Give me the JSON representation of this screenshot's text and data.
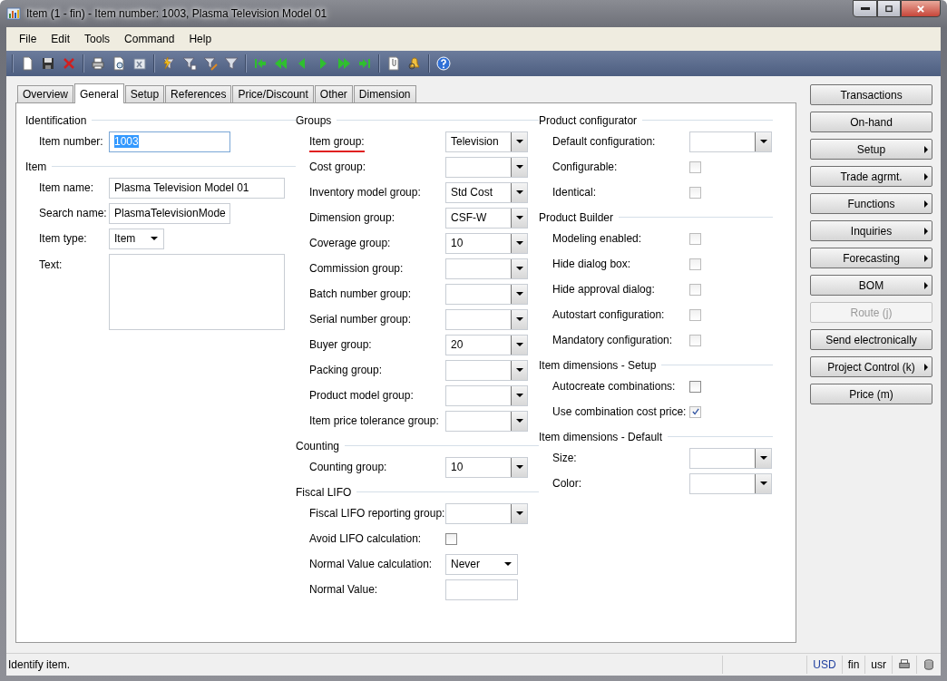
{
  "window": {
    "title": "Item (1 - fin) - Item number: 1003, Plasma Television Model 01"
  },
  "menu": [
    "File",
    "Edit",
    "Tools",
    "Command",
    "Help"
  ],
  "tabs": [
    {
      "label": "Overview",
      "selected": false
    },
    {
      "label": "General",
      "selected": true
    },
    {
      "label": "Setup",
      "selected": false
    },
    {
      "label": "References",
      "selected": false
    },
    {
      "label": "Price/Discount",
      "selected": false
    },
    {
      "label": "Other",
      "selected": false
    },
    {
      "label": "Dimension",
      "selected": false
    }
  ],
  "columns": [
    [
      {
        "title": "Identification",
        "fields": [
          {
            "kind": "text",
            "label": "Item number:",
            "value": "1003",
            "highlighted": true
          }
        ]
      },
      {
        "title": "Item",
        "fields": [
          {
            "kind": "wide",
            "label": "Item name:",
            "value": "Plasma Television Model 01"
          },
          {
            "kind": "text",
            "label": "Search name:",
            "value": "PlasmaTelevisionMode"
          },
          {
            "kind": "dropdown",
            "label": "Item type:",
            "value": "Item"
          },
          {
            "kind": "memo",
            "label": "Text:"
          }
        ]
      }
    ],
    [
      {
        "title": "Groups",
        "fields": [
          {
            "kind": "combo",
            "label": "Item group:",
            "value": "Television",
            "underlined": true
          },
          {
            "kind": "combo",
            "label": "Cost group:"
          },
          {
            "kind": "combo",
            "label": "Inventory model group:",
            "value": "Std Cost"
          },
          {
            "kind": "combo",
            "label": "Dimension group:",
            "value": "CSF-W"
          },
          {
            "kind": "combo",
            "label": "Coverage group:",
            "value": "10"
          },
          {
            "kind": "combo",
            "label": "Commission group:"
          },
          {
            "kind": "combo",
            "label": "Batch number group:"
          },
          {
            "kind": "combo",
            "label": "Serial number group:"
          },
          {
            "kind": "combo",
            "label": "Buyer group:",
            "value": "20"
          },
          {
            "kind": "combo",
            "label": "Packing group:"
          },
          {
            "kind": "combo",
            "label": "Product model group:"
          },
          {
            "kind": "combo",
            "label": "Item price tolerance group:"
          }
        ]
      },
      {
        "title": "Counting",
        "fields": [
          {
            "kind": "combo",
            "label": "Counting group:",
            "value": "10"
          }
        ]
      },
      {
        "title": "Fiscal LIFO",
        "fields": [
          {
            "kind": "combo",
            "label": "Fiscal LIFO reporting group:"
          },
          {
            "kind": "checkbox",
            "label": "Avoid LIFO calculation:",
            "checked": false
          },
          {
            "kind": "dropdown",
            "label": "Normal Value calculation:",
            "value": "Never"
          },
          {
            "kind": "text",
            "label": "Normal Value:"
          }
        ]
      }
    ],
    [
      {
        "title": "Product configurator",
        "fields": [
          {
            "kind": "combo",
            "label": "Default configuration:"
          },
          {
            "kind": "checkbox",
            "label": "Configurable:",
            "checked": false
          },
          {
            "kind": "checkbox",
            "label": "Identical:",
            "checked": false
          }
        ]
      },
      {
        "title": "Product Builder",
        "fields": [
          {
            "kind": "checkbox",
            "label": "Modeling enabled:",
            "checked": false
          },
          {
            "kind": "checkbox",
            "label": "Hide dialog box:",
            "checked": false
          },
          {
            "kind": "checkbox",
            "label": "Hide approval dialog:",
            "checked": false
          },
          {
            "kind": "checkbox",
            "label": "Autostart configuration:",
            "checked": false
          },
          {
            "kind": "checkbox",
            "label": "Mandatory configuration:",
            "checked": false
          }
        ]
      },
      {
        "title": "Item dimensions - Setup",
        "fields": [
          {
            "kind": "checkbox",
            "label": "Autocreate combinations:",
            "checked": false
          },
          {
            "kind": "checkbox",
            "label": "Use combination cost price:",
            "checked": true
          }
        ]
      },
      {
        "title": "Item dimensions - Default",
        "fields": [
          {
            "kind": "combo",
            "label": "Size:"
          },
          {
            "kind": "combo",
            "label": "Color:"
          }
        ]
      }
    ]
  ],
  "side_buttons": [
    {
      "label": "Transactions",
      "disabled": false,
      "submenu": false
    },
    {
      "label": "On-hand",
      "disabled": false,
      "submenu": false
    },
    {
      "label": "Setup",
      "disabled": false,
      "submenu": true
    },
    {
      "label": "Trade agrmt.",
      "disabled": false,
      "submenu": true
    },
    {
      "label": "Functions",
      "disabled": false,
      "submenu": true
    },
    {
      "label": "Inquiries",
      "disabled": false,
      "submenu": true
    },
    {
      "label": "Forecasting",
      "disabled": false,
      "submenu": true
    },
    {
      "label": "BOM",
      "disabled": false,
      "submenu": true
    },
    {
      "label": "Route (j)",
      "disabled": true,
      "submenu": false
    },
    {
      "label": "Send electronically",
      "disabled": false,
      "submenu": false
    },
    {
      "label": "Project Control (k)",
      "disabled": false,
      "submenu": true
    },
    {
      "label": "Price (m)",
      "disabled": false,
      "submenu": false
    }
  ],
  "status_bar": {
    "message": "Identify item.",
    "currency": "USD",
    "company": "fin",
    "user": "usr"
  }
}
